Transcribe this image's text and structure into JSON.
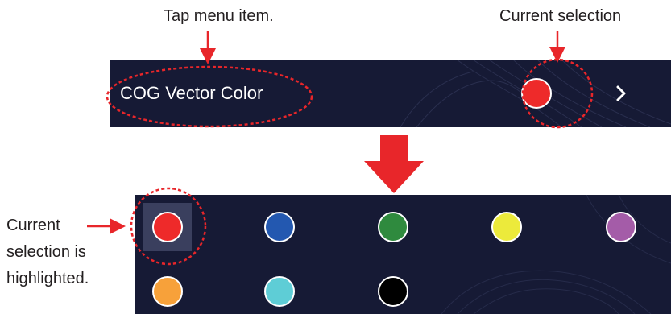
{
  "callouts": {
    "tap_menu_item": "Tap menu item.",
    "current_selection": "Current selection",
    "current_highlighted": "Current selection is highlighted."
  },
  "menu": {
    "label": "COG Vector Color",
    "current_color": "#ee2a2a",
    "chevron_icon": "chevron-right-icon"
  },
  "palette": {
    "colors": [
      "#ee2a2a",
      "#2358b0",
      "#2f8a3e",
      "#ecea3b",
      "#a45ca8",
      "#f7a13a",
      "#5ecdd6",
      "#000000"
    ],
    "selected_index": 0
  },
  "accent": "#e8262a"
}
